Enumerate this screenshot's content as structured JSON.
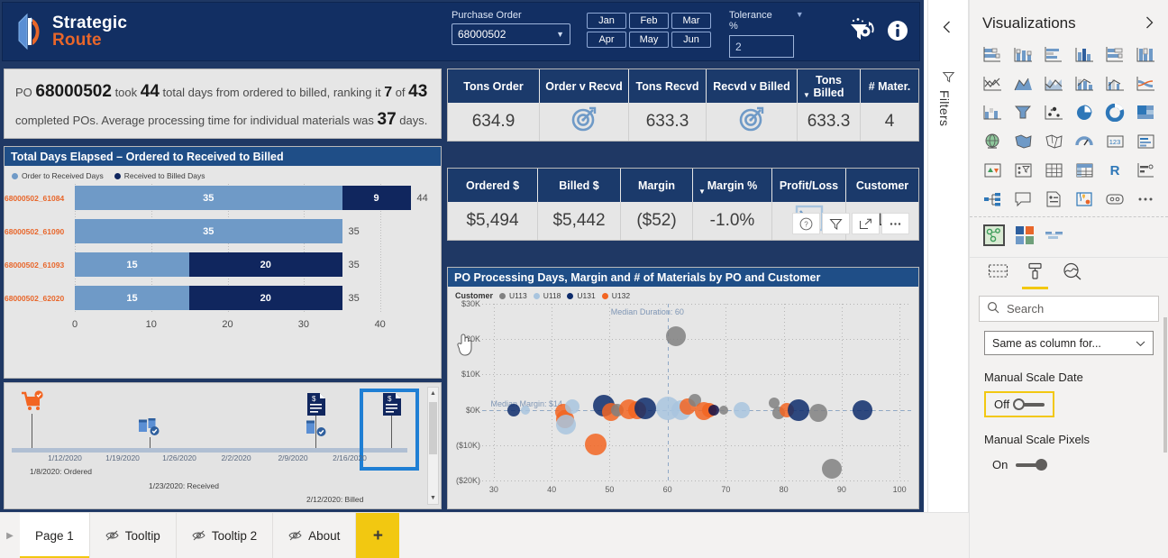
{
  "header": {
    "logo_line1": "Strategic",
    "logo_line2": "Route",
    "po_label": "Purchase Order",
    "po_value": "68000502",
    "months": [
      "Jan",
      "Feb",
      "Mar",
      "Apr",
      "May",
      "Jun"
    ],
    "tolerance_label": "Tolerance %",
    "tolerance_value": "2",
    "reset_filters_icon": "reset-filters-icon",
    "info_icon": "info-icon"
  },
  "narrative": {
    "t1": "PO ",
    "po": "68000502",
    "t2": " took ",
    "days": "44",
    "t3": " total days from ordered to billed, ranking it ",
    "rank": "7",
    "t4": " of ",
    "total": "43",
    "t5": " completed POs. Average processing time for individual materials was ",
    "avg": "37",
    "t6": " days."
  },
  "bar_visual": {
    "title": "Total Days Elapsed – Ordered to Received to Billed",
    "legend": [
      {
        "label": "Order to Received Days",
        "color": "#6f9ac7"
      },
      {
        "label": "Received to Billed Days",
        "color": "#10265e"
      }
    ],
    "header_icons": [
      "help-icon",
      "filter-icon",
      "focus-mode-icon",
      "more-options-icon"
    ]
  },
  "chart_data": [
    {
      "type": "bar",
      "title": "Total Days Elapsed – Ordered to Received to Billed",
      "orientation": "horizontal",
      "stacked": true,
      "categories": [
        "68000502_61084",
        "68000502_61090",
        "68000502_61093",
        "68000502_62020"
      ],
      "series": [
        {
          "name": "Order to Received Days",
          "color": "#6f9ac7",
          "values": [
            35,
            35,
            15,
            15
          ]
        },
        {
          "name": "Received to Billed Days",
          "color": "#10265e",
          "values": [
            9,
            0,
            20,
            20
          ]
        }
      ],
      "totals": [
        44,
        35,
        35,
        35
      ],
      "xlabel": "",
      "ylabel": "",
      "xticks": [
        0,
        10,
        20,
        30,
        40
      ],
      "xlim": [
        0,
        47
      ],
      "grid": true
    },
    {
      "type": "scatter",
      "title": "PO Processing Days, Margin and # of Materials by PO and Customer",
      "legend_title": "Customer",
      "legend_position": "top",
      "legend": [
        {
          "label": "U113",
          "color": "#808080"
        },
        {
          "label": "U118",
          "color": "#a8c4de"
        },
        {
          "label": "U131",
          "color": "#0d2b6b"
        },
        {
          "label": "U132",
          "color": "#f26522"
        }
      ],
      "xlabel": "",
      "ylabel": "",
      "xticks": [
        30,
        40,
        50,
        60,
        70,
        80,
        90,
        100
      ],
      "yticks": [
        "$30K",
        "$20K",
        "$10K",
        "$0K",
        "($10K)",
        "($20K)"
      ],
      "xlim": [
        28,
        102
      ],
      "ylim": [
        -20000,
        30000
      ],
      "reference_lines": [
        {
          "label": "Median Duration: 60",
          "axis": "x",
          "value": 60
        },
        {
          "label": "Median Margin: $14",
          "axis": "y",
          "value": 14
        }
      ],
      "points": [
        {
          "x": 33.5,
          "y": 0,
          "r": 7,
          "c": "#0d2b6b"
        },
        {
          "x": 35.5,
          "y": 0,
          "r": 5,
          "c": "#a8c4de"
        },
        {
          "x": 42.0,
          "y": -600,
          "r": 9,
          "c": "#f26522"
        },
        {
          "x": 42.3,
          "y": -2600,
          "r": 10,
          "c": "#f26522"
        },
        {
          "x": 42.5,
          "y": -4200,
          "r": 11,
          "c": "#a8c4de"
        },
        {
          "x": 43.6,
          "y": 900,
          "r": 8,
          "c": "#a8c4de"
        },
        {
          "x": 47.6,
          "y": -9800,
          "r": 12,
          "c": "#f26522"
        },
        {
          "x": 49.0,
          "y": 1100,
          "r": 12,
          "c": "#0d2b6b"
        },
        {
          "x": 50.2,
          "y": -500,
          "r": 10,
          "c": "#f26522"
        },
        {
          "x": 51.3,
          "y": 0,
          "r": 7,
          "c": "#808080"
        },
        {
          "x": 53.4,
          "y": 200,
          "r": 11,
          "c": "#f26522"
        },
        {
          "x": 54.7,
          "y": 0,
          "r": 10,
          "c": "#f26522"
        },
        {
          "x": 56.1,
          "y": 300,
          "r": 12,
          "c": "#0d2b6b"
        },
        {
          "x": 60.0,
          "y": 400,
          "r": 13,
          "c": "#a8c4de"
        },
        {
          "x": 62.3,
          "y": 0,
          "r": 11,
          "c": "#a8c4de"
        },
        {
          "x": 63.4,
          "y": 800,
          "r": 9,
          "c": "#f26522"
        },
        {
          "x": 64.7,
          "y": 2600,
          "r": 7,
          "c": "#808080"
        },
        {
          "x": 61.5,
          "y": 20900,
          "r": 11,
          "c": "#808080"
        },
        {
          "x": 66.2,
          "y": -300,
          "r": 10,
          "c": "#f26522"
        },
        {
          "x": 67.2,
          "y": 0,
          "r": 8,
          "c": "#f26522"
        },
        {
          "x": 67.9,
          "y": 0,
          "r": 6,
          "c": "#10104a"
        },
        {
          "x": 69.6,
          "y": 0,
          "r": 5,
          "c": "#808080"
        },
        {
          "x": 72.8,
          "y": 0,
          "r": 9,
          "c": "#a8c4de"
        },
        {
          "x": 78.3,
          "y": 1900,
          "r": 6,
          "c": "#808080"
        },
        {
          "x": 79.2,
          "y": -900,
          "r": 7,
          "c": "#808080"
        },
        {
          "x": 80.6,
          "y": 0,
          "r": 8,
          "c": "#f26522"
        },
        {
          "x": 82.6,
          "y": 0,
          "r": 12,
          "c": "#0d2b6b"
        },
        {
          "x": 86.0,
          "y": -900,
          "r": 10,
          "c": "#808080"
        },
        {
          "x": 88.3,
          "y": -16800,
          "r": 11,
          "c": "#808080"
        },
        {
          "x": 93.6,
          "y": 0,
          "r": 11,
          "c": "#0d2b6b"
        }
      ]
    }
  ],
  "kpi_tons": {
    "headers": [
      "Tons Order",
      "Order v Recvd",
      "Tons Recvd",
      "Recvd v Billed",
      "Tons Billed",
      "# Mater."
    ],
    "values": [
      "634.9",
      "target-icon",
      "633.3",
      "target-icon",
      "633.3",
      "4"
    ],
    "sorted_column": "Tons Billed"
  },
  "kpi_money": {
    "headers": [
      "Ordered $",
      "Billed $",
      "Margin",
      "Margin %",
      "Profit/Loss",
      "Customer"
    ],
    "values": [
      "$5,494",
      "$5,442",
      "($52)",
      "-1.0%",
      "trend-down-icon",
      "U118"
    ],
    "sorted_column": "Margin %"
  },
  "timeline": {
    "dates": [
      "1/12/2020",
      "1/19/2020",
      "1/26/2020",
      "2/2/2020",
      "2/9/2020",
      "2/16/2020"
    ],
    "events": [
      {
        "label": "1/8/2020: Ordered",
        "icon": "cart-ordered-icon"
      },
      {
        "label": "1/23/2020: Received",
        "icon": "box-received-icon"
      },
      {
        "label": "2/12/2020: Billed",
        "icon": "invoice-billed-icon"
      }
    ],
    "selected_icon": "invoice-billed-icon"
  },
  "filters_pane": {
    "title": "Filters",
    "collapse_icon": "chevron-left-icon",
    "funnel_icon": "filter-funnel-icon"
  },
  "viz_pane": {
    "title": "Visualizations",
    "expand_icon": "chevron-right-icon",
    "gallery": [
      "stacked-bar-chart-icon",
      "stacked-column-chart-icon",
      "clustered-bar-chart-icon",
      "clustered-column-chart-icon",
      "100-stacked-bar-chart-icon",
      "100-stacked-column-chart-icon",
      "line-chart-icon",
      "area-chart-icon",
      "stacked-area-chart-icon",
      "line-stacked-column-chart-icon",
      "line-clustered-column-chart-icon",
      "ribbon-chart-icon",
      "waterfall-chart-icon",
      "funnel-chart-icon",
      "scatter-chart-icon",
      "pie-chart-icon",
      "donut-chart-icon",
      "treemap-icon",
      "map-icon",
      "filled-map-icon",
      "shape-map-icon",
      "gauge-icon",
      "card-icon",
      "multi-row-card-icon",
      "kpi-icon",
      "slicer-icon",
      "table-icon",
      "matrix-icon",
      "r-script-visual-icon",
      "key-influencers-icon",
      "decomposition-tree-icon",
      "q-and-a-icon",
      "paginated-report-icon",
      "arcgis-maps-icon",
      "power-apps-icon",
      "more-visuals-icon"
    ],
    "custom_visuals": [
      "timeline-storyteller-icon",
      "custom-visual-icon",
      "custom-scale-visual-icon"
    ],
    "format_tabs": [
      "fields-tab",
      "format-tab",
      "analytics-tab"
    ],
    "active_format_tab": "format-tab",
    "search_placeholder": "Search",
    "column_format_value": "Same as column for...",
    "settings": [
      {
        "label": "Manual Scale Date",
        "state": "Off",
        "focused": true
      },
      {
        "label": "Manual Scale Pixels",
        "state": "On",
        "focused": false
      }
    ]
  },
  "page_tabs": {
    "prev_icon": "chevron-right-icon",
    "tabs": [
      {
        "label": "Page 1",
        "hidden": false,
        "active": true
      },
      {
        "label": "Tooltip",
        "hidden": true,
        "active": false
      },
      {
        "label": "Tooltip 2",
        "hidden": true,
        "active": false
      },
      {
        "label": "About",
        "hidden": true,
        "active": false
      }
    ],
    "add_label": "+"
  },
  "colors": {
    "brand_navy": "#122f63",
    "brand_orange": "#e8662a",
    "accent_yellow": "#f2c811",
    "series_light": "#6f9ac7",
    "series_dark": "#10265e"
  }
}
